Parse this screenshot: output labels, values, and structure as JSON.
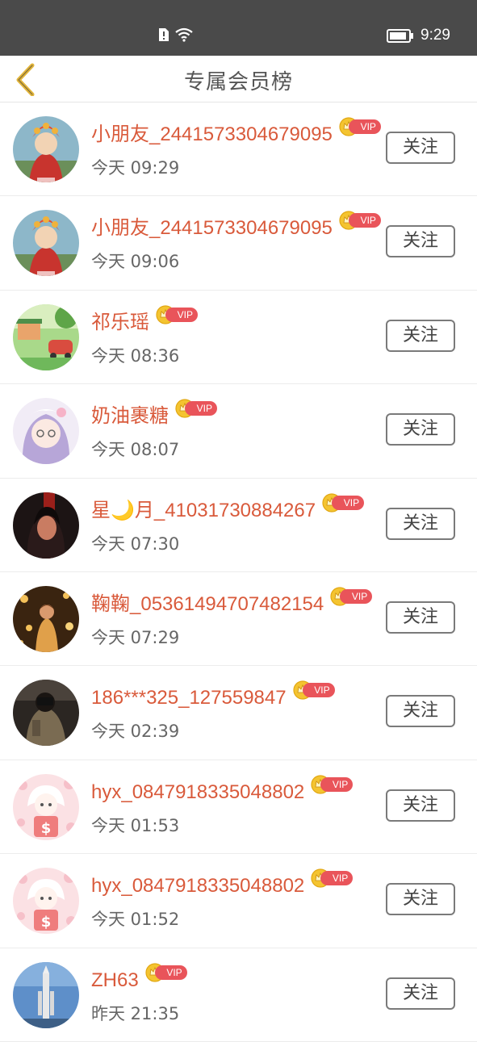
{
  "status_bar": {
    "time": "9:29",
    "icons": [
      "sim-alert-icon",
      "wifi-icon",
      "battery-icon"
    ]
  },
  "header": {
    "title": "专属会员榜",
    "back_icon": "chevron-left-icon"
  },
  "vip_badge": "VIP",
  "follow_label": "关注",
  "colors": {
    "name": "#d95a3b",
    "vip": "#e9545a",
    "back_arrow": "#e2b53a",
    "status_bar": "#4a4a4a"
  },
  "members": [
    {
      "name": "小朋友_2441573304679095",
      "time": "今天 09:29",
      "avatar": "red-costume-avatar"
    },
    {
      "name": "小朋友_2441573304679095",
      "time": "今天 09:06",
      "avatar": "red-costume-avatar"
    },
    {
      "name": "祁乐瑶",
      "time": "今天 08:36",
      "avatar": "green-scenery-avatar"
    },
    {
      "name": "奶油裹糖",
      "time": "今天 08:07",
      "avatar": "anime-girl-avatar"
    },
    {
      "name": "星🌙月_41031730884267",
      "time": "今天 07:30",
      "avatar": "dark-portrait-avatar"
    },
    {
      "name": "鞠鞠_05361494707482154",
      "time": "今天 07:29",
      "avatar": "night-lights-avatar"
    },
    {
      "name": "186***325_127559847",
      "time": "今天 02:39",
      "avatar": "dark-photo-avatar"
    },
    {
      "name": "hyx_0847918335048802",
      "time": "今天 01:53",
      "avatar": "cartoon-girl-avatar"
    },
    {
      "name": "hyx_0847918335048802",
      "time": "今天 01:52",
      "avatar": "cartoon-girl-avatar"
    },
    {
      "name": "ZH63",
      "time": "昨天 21:35",
      "avatar": "rocket-avatar"
    }
  ]
}
